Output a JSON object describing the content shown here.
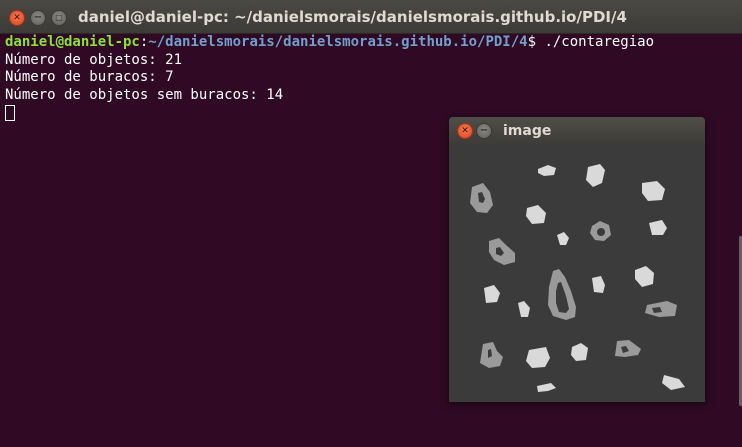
{
  "terminal": {
    "title": "daniel@daniel-pc: ~/danielsmorais/danielsmorais.github.io/PDI/4",
    "prompt_user": "daniel@daniel-pc",
    "prompt_sep": ":",
    "prompt_path": "~/danielsmorais/danielsmorais.github.io/PDI/4",
    "prompt_symbol": "$ ",
    "command": "./contaregiao",
    "output": [
      "Número de objetos: 21",
      "Número de buracos: 7",
      "Número de objetos sem buracos: 14"
    ],
    "colors": {
      "background": "#300a24",
      "user": "#8ae234",
      "path": "#729fcf",
      "text": "#ffffff"
    }
  },
  "image_window": {
    "title": "image",
    "blob_colors": {
      "background": "#3b3b3b",
      "solid_object": "#d9d9d9",
      "object_with_hole": "#9a9a9a",
      "hole": "#3b3b3b"
    }
  },
  "icons": {
    "close": "close-icon",
    "minimize": "minimize-icon",
    "maximize": "maximize-icon"
  }
}
